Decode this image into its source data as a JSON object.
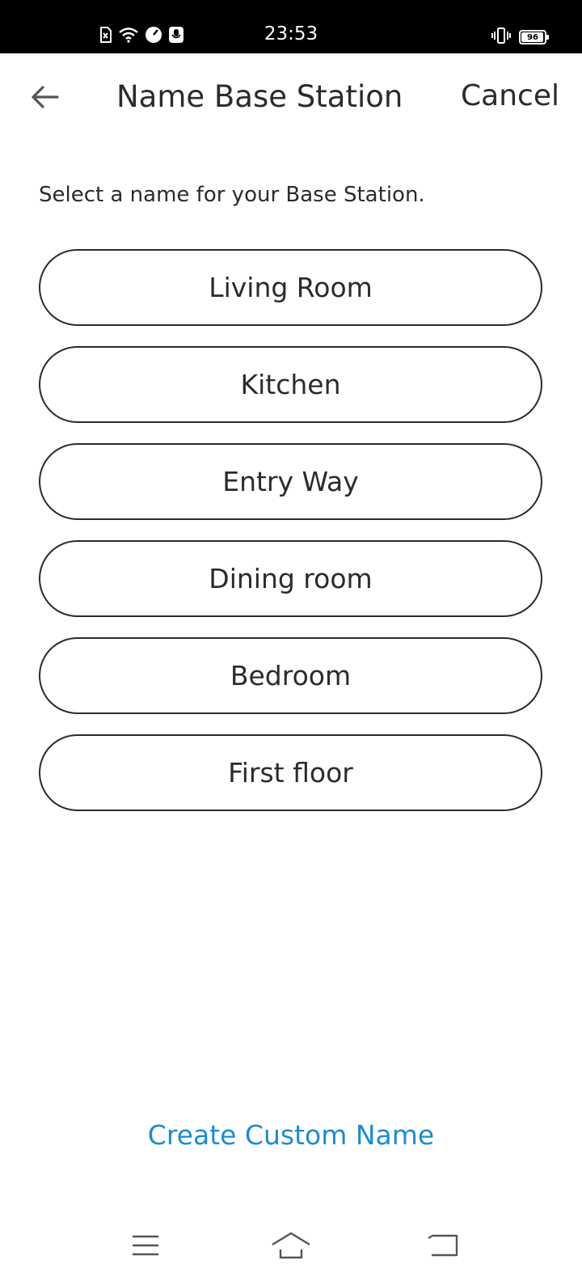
{
  "status_bar": {
    "time": "23:53",
    "battery_level": "96",
    "icons": [
      "sim-off-icon",
      "wifi-icon",
      "speedometer-icon",
      "mic-icon",
      "vibrate-icon",
      "battery-icon"
    ]
  },
  "header": {
    "title": "Name Base Station",
    "cancel_label": "Cancel",
    "back_icon": "arrow-left-icon"
  },
  "instruction": "Select a name for your Base Station.",
  "name_options": [
    {
      "label": "Living Room"
    },
    {
      "label": "Kitchen"
    },
    {
      "label": "Entry Way"
    },
    {
      "label": "Dining room"
    },
    {
      "label": "Bedroom"
    },
    {
      "label": "First floor"
    }
  ],
  "custom_name_label": "Create Custom Name",
  "nav_bar": {
    "icons": [
      "menu-icon",
      "home-icon",
      "back-icon"
    ]
  },
  "colors": {
    "accent": "#1e8ccd",
    "text": "#2b2b2b",
    "status_bar": "#000000"
  }
}
